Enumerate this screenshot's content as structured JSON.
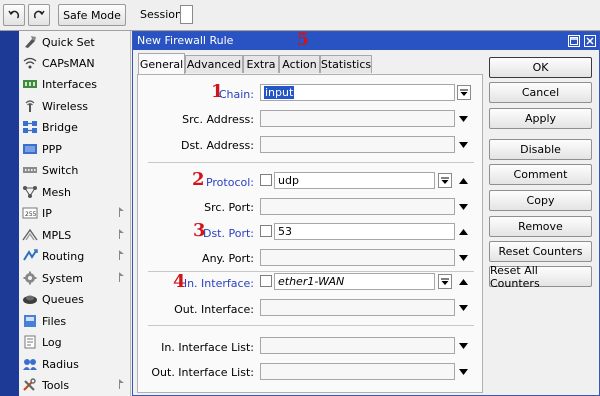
{
  "toolbar": {
    "undo_icon": "undo-icon",
    "redo_icon": "redo-icon",
    "safe_mode_label": "Safe Mode",
    "session_label": "Session:"
  },
  "sidebar": {
    "items": [
      {
        "label": "Quick Set",
        "icon": "quick-set-icon",
        "submenu": false
      },
      {
        "label": "CAPsMAN",
        "icon": "capsman-icon",
        "submenu": false
      },
      {
        "label": "Interfaces",
        "icon": "interfaces-icon",
        "submenu": false
      },
      {
        "label": "Wireless",
        "icon": "wireless-icon",
        "submenu": false
      },
      {
        "label": "Bridge",
        "icon": "bridge-icon",
        "submenu": false
      },
      {
        "label": "PPP",
        "icon": "ppp-icon",
        "submenu": false
      },
      {
        "label": "Switch",
        "icon": "switch-icon",
        "submenu": false
      },
      {
        "label": "Mesh",
        "icon": "mesh-icon",
        "submenu": false
      },
      {
        "label": "IP",
        "icon": "ip-icon",
        "submenu": true
      },
      {
        "label": "MPLS",
        "icon": "mpls-icon",
        "submenu": true
      },
      {
        "label": "Routing",
        "icon": "routing-icon",
        "submenu": true
      },
      {
        "label": "System",
        "icon": "system-icon",
        "submenu": true
      },
      {
        "label": "Queues",
        "icon": "queues-icon",
        "submenu": false
      },
      {
        "label": "Files",
        "icon": "files-icon",
        "submenu": false
      },
      {
        "label": "Log",
        "icon": "log-icon",
        "submenu": false
      },
      {
        "label": "Radius",
        "icon": "radius-icon",
        "submenu": false
      },
      {
        "label": "Tools",
        "icon": "tools-icon",
        "submenu": true
      }
    ]
  },
  "dialog": {
    "title": "New Firewall Rule",
    "annotation_title": "5",
    "tabs": [
      {
        "label": "General",
        "active": true
      },
      {
        "label": "Advanced",
        "active": false
      },
      {
        "label": "Extra",
        "active": false
      },
      {
        "label": "Action",
        "active": false
      },
      {
        "label": "Statistics",
        "active": false
      }
    ],
    "fields": {
      "chain": {
        "label": "Chain:",
        "value": "input",
        "annotation": "1"
      },
      "src_address": {
        "label": "Src. Address:",
        "value": ""
      },
      "dst_address": {
        "label": "Dst. Address:",
        "value": ""
      },
      "protocol": {
        "label": "Protocol:",
        "value": "udp",
        "annotation": "2"
      },
      "src_port": {
        "label": "Src. Port:",
        "value": ""
      },
      "dst_port": {
        "label": "Dst. Port:",
        "value": "53",
        "annotation": "3"
      },
      "any_port": {
        "label": "Any. Port:",
        "value": ""
      },
      "in_interface": {
        "label": "In. Interface:",
        "value": "ether1-WAN",
        "annotation": "4"
      },
      "out_interface": {
        "label": "Out. Interface:",
        "value": ""
      },
      "in_interface_list": {
        "label": "In. Interface List:",
        "value": ""
      },
      "out_interface_list": {
        "label": "Out. Interface List:",
        "value": ""
      }
    },
    "buttons": {
      "ok": "OK",
      "cancel": "Cancel",
      "apply": "Apply",
      "disable": "Disable",
      "comment": "Comment",
      "copy": "Copy",
      "remove": "Remove",
      "reset_counters": "Reset Counters",
      "reset_all_counters": "Reset All Counters"
    }
  },
  "colors": {
    "title_bar": "#2952c2",
    "left_strip": "#1c3a96",
    "annotation": "#d0141c",
    "field_label_highlight": "#2a3fc0",
    "selection": "#2456c8"
  }
}
